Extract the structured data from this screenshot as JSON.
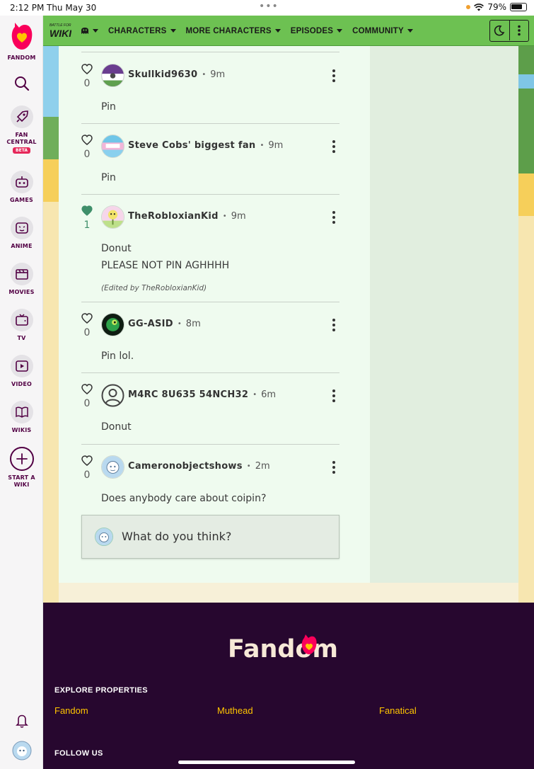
{
  "status_bar": {
    "time": "2:12 PM",
    "date": "Thu May 30",
    "battery": "79%"
  },
  "sidebar": {
    "brand": "FANDOM",
    "items": [
      {
        "icon": "search-icon",
        "label": ""
      },
      {
        "icon": "rocket-icon",
        "label": "FAN CENTRAL",
        "badge": "BETA"
      },
      {
        "icon": "gamepad-icon",
        "label": "GAMES"
      },
      {
        "icon": "anime-face-icon",
        "label": "ANIME"
      },
      {
        "icon": "clapperboard-icon",
        "label": "MOVIES"
      },
      {
        "icon": "tv-icon",
        "label": "TV"
      },
      {
        "icon": "play-icon",
        "label": "VIDEO"
      },
      {
        "icon": "book-icon",
        "label": "WIKIS"
      },
      {
        "icon": "plus-icon",
        "label": "START A WIKI"
      }
    ],
    "bottom": [
      {
        "icon": "bell-icon"
      },
      {
        "icon": "user-avatar-icon"
      }
    ]
  },
  "wiki_nav": {
    "logo_text": "WIKI",
    "items": [
      {
        "label": ""
      },
      {
        "label": "CHARACTERS"
      },
      {
        "label": "MORE CHARACTERS"
      },
      {
        "label": "EPISODES"
      },
      {
        "label": "COMMUNITY"
      }
    ],
    "tools": [
      "moon-icon",
      "more-vertical-icon"
    ]
  },
  "replies": [
    {
      "author": "Skullkid9630",
      "time": "9m",
      "likes": "0",
      "liked": false,
      "lines": [
        "Pin"
      ],
      "edited": "",
      "avatar_colors": [
        "#6a3d8f",
        "#ffffff",
        "#5fa04e"
      ]
    },
    {
      "author": "Steve Cobs' biggest fan",
      "time": "9m",
      "likes": "0",
      "liked": false,
      "lines": [
        "Pin"
      ],
      "edited": "",
      "avatar_colors": [
        "#6fc6e8",
        "#f2b6d8",
        "#ffffff"
      ]
    },
    {
      "author": "TheRobloxianKid",
      "time": "9m",
      "likes": "1",
      "liked": true,
      "lines": [
        "Donut",
        "PLEASE NOT PIN AGHHHH"
      ],
      "edited": "(Edited by TheRobloxianKid)",
      "avatar_colors": [
        "#f6d6ea",
        "#f2e46a",
        "#6a8e3a"
      ]
    },
    {
      "author": "GG-ASID",
      "time": "8m",
      "likes": "0",
      "liked": false,
      "lines": [
        "Pin lol."
      ],
      "edited": "",
      "avatar_colors": [
        "#0f1d12",
        "#2ea34a",
        "#c5e85a"
      ]
    },
    {
      "author": "M4RC 8U635 54NCH32",
      "time": "6m",
      "likes": "0",
      "liked": false,
      "lines": [
        "Donut"
      ],
      "edited": "",
      "avatar_colors": [
        "#effbef",
        "#444444",
        "#444444"
      ]
    },
    {
      "author": "Cameronobjectshows",
      "time": "2m",
      "likes": "0",
      "liked": false,
      "lines": [
        "Does anybody care about coipin?"
      ],
      "edited": "",
      "avatar_colors": [
        "#b9d9ef",
        "#ffffff",
        "#5a7a9a"
      ]
    }
  ],
  "composer": {
    "placeholder": "What do you think?"
  },
  "footer": {
    "wordmark": "Fandom",
    "explore_heading": "EXPLORE PROPERTIES",
    "links": [
      "Fandom",
      "Muthead",
      "Fanatical"
    ],
    "follow_heading": "FOLLOW US"
  },
  "colors": {
    "nav_green": "#6dc152",
    "content_bg": "#effbef",
    "rail_bg": "#e1eedf",
    "footer_bg": "#27072f",
    "footer_link": "#ffc500",
    "brand_pink": "#fa005a",
    "liked_heart": "#3f8f6a"
  }
}
